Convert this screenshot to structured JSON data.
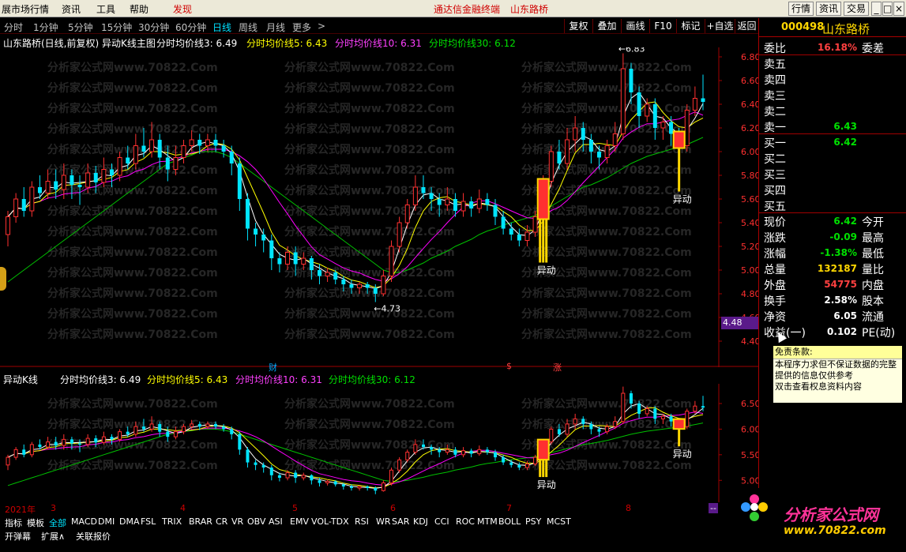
{
  "menu": {
    "items": [
      "展市场行情",
      "资讯",
      "工具",
      "帮助",
      "发现"
    ],
    "center_links": [
      "通达信金融终端",
      "山东路桥"
    ],
    "right_buttons": [
      "行情",
      "资讯",
      "交易",
      "最小化",
      "最大化",
      "关闭"
    ]
  },
  "periods": [
    "分时",
    "1分钟",
    "5分钟",
    "15分钟",
    "30分钟",
    "60分钟",
    "日线",
    "周线",
    "月线",
    "更多"
  ],
  "active_period": "日线",
  "tools": [
    "复权",
    "叠加",
    "画线",
    "F10",
    "标记",
    "+自选",
    "返回"
  ],
  "main_info": {
    "title": "山东路桥(日线,前复权) 异动K线主图",
    "ma3": "分时均价线3: 6.49",
    "ma5": "分时均价线5: 6.43",
    "ma10": "分时均价线10: 6.31",
    "ma30": "分时均价线30: 6.12"
  },
  "sub_info": {
    "title": "异动K线",
    "ma3": "分时均价线3: 6.49",
    "ma5": "分时均价线5: 6.43",
    "ma10": "分时均价线10: 6.31",
    "ma30": "分时均价线30: 6.12"
  },
  "annotations": {
    "high": "6.83",
    "low": "4.73",
    "mark": "异动",
    "current": "4.48",
    "cai": "财",
    "s": "$",
    "zhang": "涨"
  },
  "y_axis_main": [
    "6.80",
    "6.60",
    "6.40",
    "6.20",
    "6.00",
    "5.80",
    "5.60",
    "5.40",
    "5.20",
    "5.00",
    "4.80",
    "4.60",
    "4.40"
  ],
  "y_axis_sub": [
    "6.50",
    "6.00",
    "5.50",
    "5.00"
  ],
  "time_axis": [
    "2021年",
    "3",
    "4",
    "5",
    "6",
    "7",
    "8"
  ],
  "stock": {
    "code": "000498",
    "name": "山东路桥"
  },
  "quote_rows": [
    {
      "k": "委比",
      "v": "16.18%",
      "k2": "委差",
      "color": "#ff4040"
    },
    {
      "k": "卖五",
      "v": "",
      "k2": "",
      "color": "#fff"
    },
    {
      "k": "卖四",
      "v": "",
      "k2": "",
      "color": "#fff"
    },
    {
      "k": "卖三",
      "v": "",
      "k2": "",
      "color": "#fff"
    },
    {
      "k": "卖二",
      "v": "",
      "k2": "",
      "color": "#fff"
    },
    {
      "k": "卖一",
      "v": "6.43",
      "k2": "",
      "color": "#00e000"
    },
    {
      "k": "买一",
      "v": "6.42",
      "k2": "",
      "color": "#00e000"
    },
    {
      "k": "买二",
      "v": "",
      "k2": "",
      "color": "#fff"
    },
    {
      "k": "买三",
      "v": "",
      "k2": "",
      "color": "#fff"
    },
    {
      "k": "买四",
      "v": "",
      "k2": "",
      "color": "#fff"
    },
    {
      "k": "买五",
      "v": "",
      "k2": "",
      "color": "#fff"
    },
    {
      "k": "现价",
      "v": "6.42",
      "k2": "今开",
      "color": "#00e000"
    },
    {
      "k": "涨跌",
      "v": "-0.09",
      "k2": "最高",
      "color": "#00e000"
    },
    {
      "k": "涨幅",
      "v": "-1.38%",
      "k2": "最低",
      "color": "#00e000"
    },
    {
      "k": "总量",
      "v": "132187",
      "k2": "量比",
      "color": "#ffd700"
    },
    {
      "k": "外盘",
      "v": "54775",
      "k2": "内盘",
      "color": "#ff4040"
    },
    {
      "k": "换手",
      "v": "2.58%",
      "k2": "股本",
      "color": "#fff"
    },
    {
      "k": "净资",
      "v": "6.05",
      "k2": "流通",
      "color": "#fff"
    },
    {
      "k": "收益(一)",
      "v": "0.102",
      "k2": "PE(动)",
      "color": "#fff"
    }
  ],
  "popup": {
    "title": "免责条款:",
    "lines": [
      "本程序力求但不保证数据的完整",
      "提供的信息仅供参考",
      "双击查看权息资料内容"
    ]
  },
  "indicator_tabs": [
    "指标",
    "模板",
    "全部",
    "MACD",
    "DMI",
    "DMA",
    "FSL",
    "TRIX",
    "BRAR",
    "CR",
    "VR",
    "OBV",
    "ASI",
    "EMV",
    "VOL-TDX",
    "RSI",
    "WR",
    "SAR",
    "KDJ",
    "CCI",
    "ROC",
    "MTM",
    "BOLL",
    "PSY",
    "MCST"
  ],
  "bottom_tabs": [
    "开弹幕",
    "扩展∧",
    "关联报价"
  ],
  "watermark": "分析家公式网www.70822.Com",
  "logo_text": "分析家公式网",
  "logo_url": "www.70822.com",
  "colors": {
    "up": "#ff3030",
    "down": "#00e5ff",
    "ma3": "#ffffff",
    "ma5": "#ffff00",
    "ma10": "#ff00ff",
    "ma30": "#00c000",
    "highlight": "#ffd700"
  },
  "candles": [
    [
      5.3,
      5.45,
      5.5,
      5.2
    ],
    [
      5.45,
      5.6,
      5.65,
      5.4
    ],
    [
      5.6,
      5.5,
      5.7,
      5.45
    ],
    [
      5.5,
      5.7,
      5.75,
      5.45
    ],
    [
      5.7,
      5.65,
      5.8,
      5.6
    ],
    [
      5.65,
      5.75,
      5.85,
      5.6
    ],
    [
      5.75,
      5.68,
      5.85,
      5.6
    ],
    [
      5.68,
      5.8,
      5.9,
      5.6
    ],
    [
      5.8,
      5.72,
      5.85,
      5.6
    ],
    [
      5.72,
      5.7,
      5.8,
      5.55
    ],
    [
      5.7,
      5.82,
      5.9,
      5.65
    ],
    [
      5.82,
      5.74,
      5.88,
      5.65
    ],
    [
      5.74,
      5.85,
      5.95,
      5.7
    ],
    [
      5.85,
      5.8,
      5.9,
      5.7
    ],
    [
      5.8,
      5.95,
      6.0,
      5.75
    ],
    [
      5.95,
      5.9,
      6.05,
      5.85
    ],
    [
      5.9,
      6.05,
      6.15,
      5.85
    ],
    [
      6.05,
      6.0,
      6.2,
      5.95
    ],
    [
      6.0,
      6.1,
      6.25,
      5.95
    ],
    [
      6.1,
      5.95,
      6.15,
      5.85
    ],
    [
      5.95,
      5.85,
      6.05,
      5.75
    ],
    [
      5.85,
      5.95,
      6.05,
      5.8
    ],
    [
      5.95,
      6.05,
      6.1,
      5.9
    ],
    [
      6.05,
      6.1,
      6.18,
      6.0
    ],
    [
      6.1,
      6.05,
      6.15,
      5.98
    ],
    [
      6.05,
      6.1,
      6.15,
      6.0
    ],
    [
      6.1,
      6.05,
      6.15,
      6.0
    ],
    [
      6.05,
      6.0,
      6.1,
      5.95
    ],
    [
      6.0,
      5.9,
      6.05,
      5.8
    ],
    [
      5.9,
      5.6,
      5.95,
      5.5
    ],
    [
      5.6,
      5.35,
      5.65,
      5.25
    ],
    [
      5.35,
      5.3,
      5.4,
      5.2
    ],
    [
      5.3,
      5.25,
      5.35,
      5.15
    ],
    [
      5.25,
      5.1,
      5.3,
      5.0
    ],
    [
      5.1,
      5.05,
      5.15,
      4.98
    ],
    [
      5.05,
      5.15,
      5.2,
      5.0
    ],
    [
      5.15,
      5.05,
      5.2,
      4.95
    ],
    [
      5.05,
      5.1,
      5.15,
      5.0
    ],
    [
      5.1,
      5.0,
      5.12,
      4.92
    ],
    [
      5.0,
      4.95,
      5.05,
      4.88
    ],
    [
      4.95,
      4.98,
      5.02,
      4.9
    ],
    [
      4.98,
      4.92,
      5.0,
      4.88
    ],
    [
      4.92,
      4.88,
      4.95,
      4.82
    ],
    [
      4.88,
      4.85,
      4.92,
      4.8
    ],
    [
      4.85,
      4.88,
      4.9,
      4.8
    ],
    [
      4.88,
      4.85,
      4.9,
      4.8
    ],
    [
      4.85,
      4.8,
      4.88,
      4.73
    ],
    [
      4.8,
      4.95,
      5.0,
      4.78
    ],
    [
      4.95,
      5.2,
      5.25,
      4.9
    ],
    [
      5.2,
      5.4,
      5.45,
      5.15
    ],
    [
      5.4,
      5.55,
      5.6,
      5.35
    ],
    [
      5.55,
      5.7,
      5.8,
      5.5
    ],
    [
      5.7,
      5.65,
      5.8,
      5.6
    ],
    [
      5.65,
      5.6,
      5.7,
      5.5
    ],
    [
      5.6,
      5.55,
      5.65,
      5.45
    ],
    [
      5.55,
      5.6,
      5.7,
      5.5
    ],
    [
      5.6,
      5.5,
      5.65,
      5.45
    ],
    [
      5.5,
      5.58,
      5.65,
      5.45
    ],
    [
      5.58,
      5.52,
      5.62,
      5.45
    ],
    [
      5.52,
      5.6,
      5.68,
      5.48
    ],
    [
      5.6,
      5.55,
      5.65,
      5.5
    ],
    [
      5.55,
      5.45,
      5.6,
      5.38
    ],
    [
      5.45,
      5.35,
      5.5,
      5.3
    ],
    [
      5.35,
      5.3,
      5.4,
      5.25
    ],
    [
      5.3,
      5.25,
      5.35,
      5.2
    ],
    [
      5.25,
      5.32,
      5.38,
      5.2
    ],
    [
      5.32,
      5.45,
      5.5,
      5.28
    ],
    [
      5.45,
      5.75,
      5.8,
      5.4
    ],
    [
      5.75,
      6.0,
      6.05,
      5.7
    ],
    [
      6.0,
      5.9,
      6.1,
      5.85
    ],
    [
      5.9,
      6.1,
      6.2,
      5.85
    ],
    [
      6.1,
      6.2,
      6.3,
      6.0
    ],
    [
      6.2,
      6.1,
      6.25,
      6.0
    ],
    [
      6.1,
      6.0,
      6.15,
      5.9
    ],
    [
      6.0,
      5.95,
      6.05,
      5.85
    ],
    [
      5.95,
      6.05,
      6.1,
      5.9
    ],
    [
      6.05,
      6.15,
      6.25,
      6.0
    ],
    [
      6.15,
      6.7,
      6.83,
      6.1
    ],
    [
      6.7,
      6.5,
      6.75,
      6.4
    ],
    [
      6.5,
      6.3,
      6.55,
      6.2
    ],
    [
      6.3,
      6.4,
      6.45,
      6.25
    ],
    [
      6.4,
      6.2,
      6.45,
      6.1
    ],
    [
      6.2,
      6.25,
      6.3,
      6.1
    ],
    [
      6.25,
      6.15,
      6.3,
      6.05
    ],
    [
      6.15,
      6.05,
      6.2,
      6.0
    ],
    [
      6.05,
      6.35,
      6.4,
      6.0
    ],
    [
      6.35,
      6.45,
      6.55,
      6.3
    ],
    [
      6.45,
      6.42,
      6.65,
      6.35
    ]
  ],
  "ma30_values": [
    4.9,
    4.95,
    5.0,
    5.05,
    5.1,
    5.15,
    5.2,
    5.25,
    5.3,
    5.35,
    5.4,
    5.45,
    5.5,
    5.55,
    5.6,
    5.65,
    5.7,
    5.75,
    5.8,
    5.85,
    5.9,
    5.92,
    5.95,
    5.97,
    6.0,
    6.0,
    6.0,
    5.98,
    5.95,
    5.9,
    5.85,
    5.8,
    5.75,
    5.7,
    5.65,
    5.6,
    5.55,
    5.5,
    5.45,
    5.4,
    5.35,
    5.3,
    5.25,
    5.2,
    5.15,
    5.1,
    5.05,
    5.0,
    4.98,
    4.98,
    5.0,
    5.03,
    5.06,
    5.1,
    5.13,
    5.16,
    5.2,
    5.23,
    5.26,
    5.3,
    5.33,
    5.35,
    5.38,
    5.4,
    5.42,
    5.44,
    5.46,
    5.5,
    5.54,
    5.58,
    5.62,
    5.66,
    5.7,
    5.72,
    5.75,
    5.78,
    5.82,
    5.86,
    5.9,
    5.93,
    5.96,
    5.98,
    6.0,
    6.02,
    6.04,
    6.06,
    6.09,
    6.12
  ],
  "markers_index": [
    67,
    84
  ]
}
